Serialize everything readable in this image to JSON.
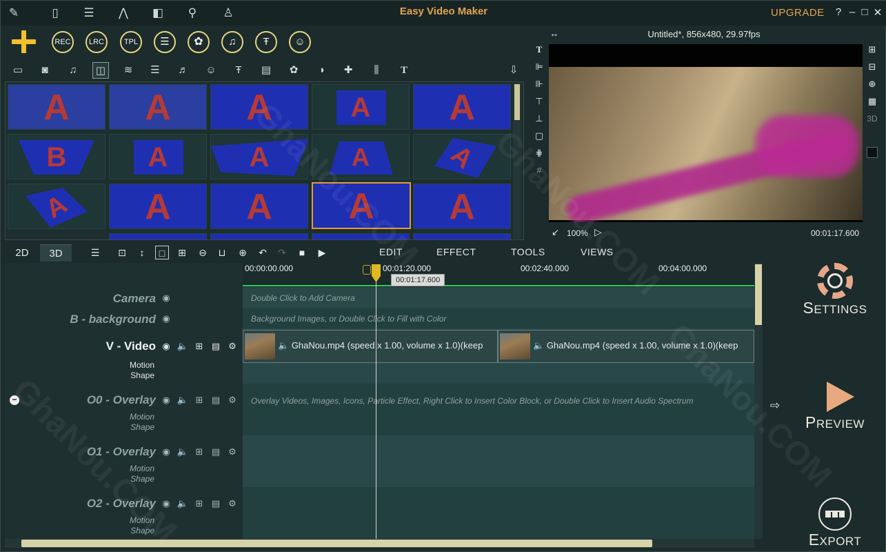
{
  "app": {
    "title": "Easy Video Maker",
    "upgrade": "UPGRADE",
    "help": "?",
    "minimize": "–",
    "maximize": "□",
    "close": "✕"
  },
  "toolbar": {
    "rec": "REC",
    "lrc": "LRC",
    "tpl": "TPL"
  },
  "preview": {
    "title": "Untitled*, 856x480, 29.97fps",
    "zoom": "100%",
    "time": "00:01:17.600",
    "side3d": "3D"
  },
  "modes": {
    "d2": "2D",
    "d3": "3D"
  },
  "menus": {
    "edit": "EDIT",
    "effect": "EFFECT",
    "tools": "TOOLS",
    "views": "VIEWS"
  },
  "ruler": {
    "t0": "00:00:00.000",
    "t1": "00:01:20.000",
    "t2": "00:02:40.000",
    "t3": "00:04:00.000",
    "playhead": "00:01:17.600"
  },
  "tracks": {
    "camera": {
      "name": "Camera",
      "hint": "Double Click to Add Camera"
    },
    "background": {
      "name": "B - background",
      "hint": "Background Images, or Double Click to Fill with Color"
    },
    "video": {
      "name": "V - Video",
      "motion": "Motion",
      "shape": "Shape",
      "clip1": "GhaNou.mp4  (speed x 1.00, volume x 1.0)(keep",
      "clip2": "GhaNou.mp4  (speed x 1.00, volume x 1.0)(keep"
    },
    "o0": {
      "name": "O0 - Overlay",
      "motion": "Motion",
      "shape": "Shape",
      "hint": "Overlay Videos, Images, Icons, Particle Effect, Right Click to Insert Color Block, or Double Click to Insert Audio Spectrum"
    },
    "o1": {
      "name": "O1 - Overlay",
      "motion": "Motion",
      "shape": "Shape"
    },
    "o2": {
      "name": "O2 - Overlay",
      "motion": "Motion",
      "shape": "Shape"
    }
  },
  "actions": {
    "settings": {
      "first": "S",
      "rest": "ETTINGS"
    },
    "preview": {
      "first": "P",
      "rest": "REVIEW"
    },
    "export": {
      "first": "E",
      "rest": "XPORT"
    }
  },
  "watermark": "GhaNou.COM",
  "colors": {
    "accent": "#e3a552",
    "timeline_green": "#2fcc56",
    "selection": "#e39a3a",
    "thumb_blue": "#1f2fb2",
    "thumb_letter": "#b63a35"
  }
}
